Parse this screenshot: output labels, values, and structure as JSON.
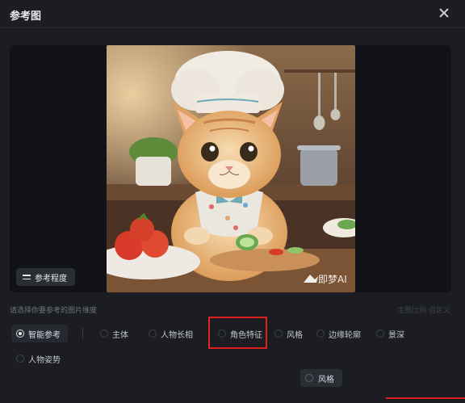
{
  "dialog": {
    "title": "参考图",
    "close_icon": "close-icon"
  },
  "preview": {
    "degree_label": "参考程度",
    "degree_icon": "sliders-icon",
    "watermark": "即梦AI"
  },
  "dimension_hint": "请选择你要参考的图片维度",
  "ratio_label": "生图比例 自定义",
  "options": [
    {
      "label": "智能参考",
      "selected": true
    },
    {
      "label": "主体",
      "selected": false
    },
    {
      "label": "人物长相",
      "selected": false
    },
    {
      "label": "角色特征",
      "selected": false
    },
    {
      "label": "风格",
      "selected": false
    },
    {
      "label": "边缘轮廓",
      "selected": false
    },
    {
      "label": "景深",
      "selected": false
    },
    {
      "label": "人物姿势",
      "selected": false
    }
  ],
  "hover_tooltip": "风格",
  "colors": {
    "highlight": "#e0211f",
    "background": "#1b1d22"
  }
}
